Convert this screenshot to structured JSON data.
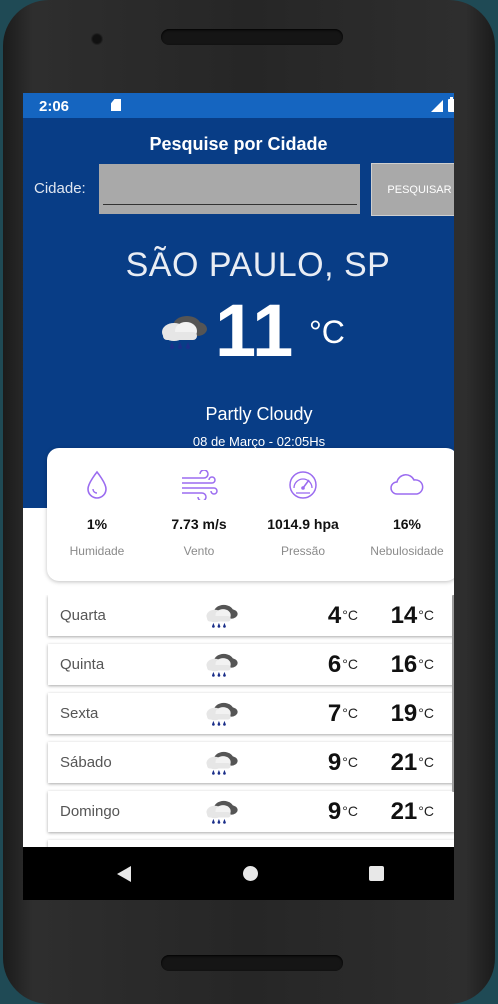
{
  "status_bar": {
    "time": "2:06"
  },
  "search": {
    "title": "Pesquise por Cidade",
    "label": "Cidade:",
    "input_value": "",
    "button_label": "PESQUISAR"
  },
  "current": {
    "city": "SÃO PAULO, SP",
    "temperature": "11",
    "unit": "°C",
    "condition": "Partly Cloudy",
    "datetime": "08 de Março - 02:05Hs",
    "icon": "rain-cloud-icon"
  },
  "metrics": [
    {
      "value": "1%",
      "label": "Humidade",
      "icon": "water-drop-icon"
    },
    {
      "value": "7.73 m/s",
      "label": "Vento",
      "icon": "wind-icon"
    },
    {
      "value": "1014.9 hpa",
      "label": "Pressão",
      "icon": "gauge-icon"
    },
    {
      "value": "16%",
      "label": "Nebulosidade",
      "icon": "cloud-icon"
    }
  ],
  "forecast_unit": "°C",
  "forecast": [
    {
      "day": "Quarta",
      "low": "4",
      "high": "14"
    },
    {
      "day": "Quinta",
      "low": "6",
      "high": "16"
    },
    {
      "day": "Sexta",
      "low": "7",
      "high": "19"
    },
    {
      "day": "Sábado",
      "low": "9",
      "high": "21"
    },
    {
      "day": "Domingo",
      "low": "9",
      "high": "21"
    }
  ],
  "colors": {
    "status_bar": "#1565c0",
    "hero": "#083d86",
    "accent_icons": "#9b6cf0"
  }
}
